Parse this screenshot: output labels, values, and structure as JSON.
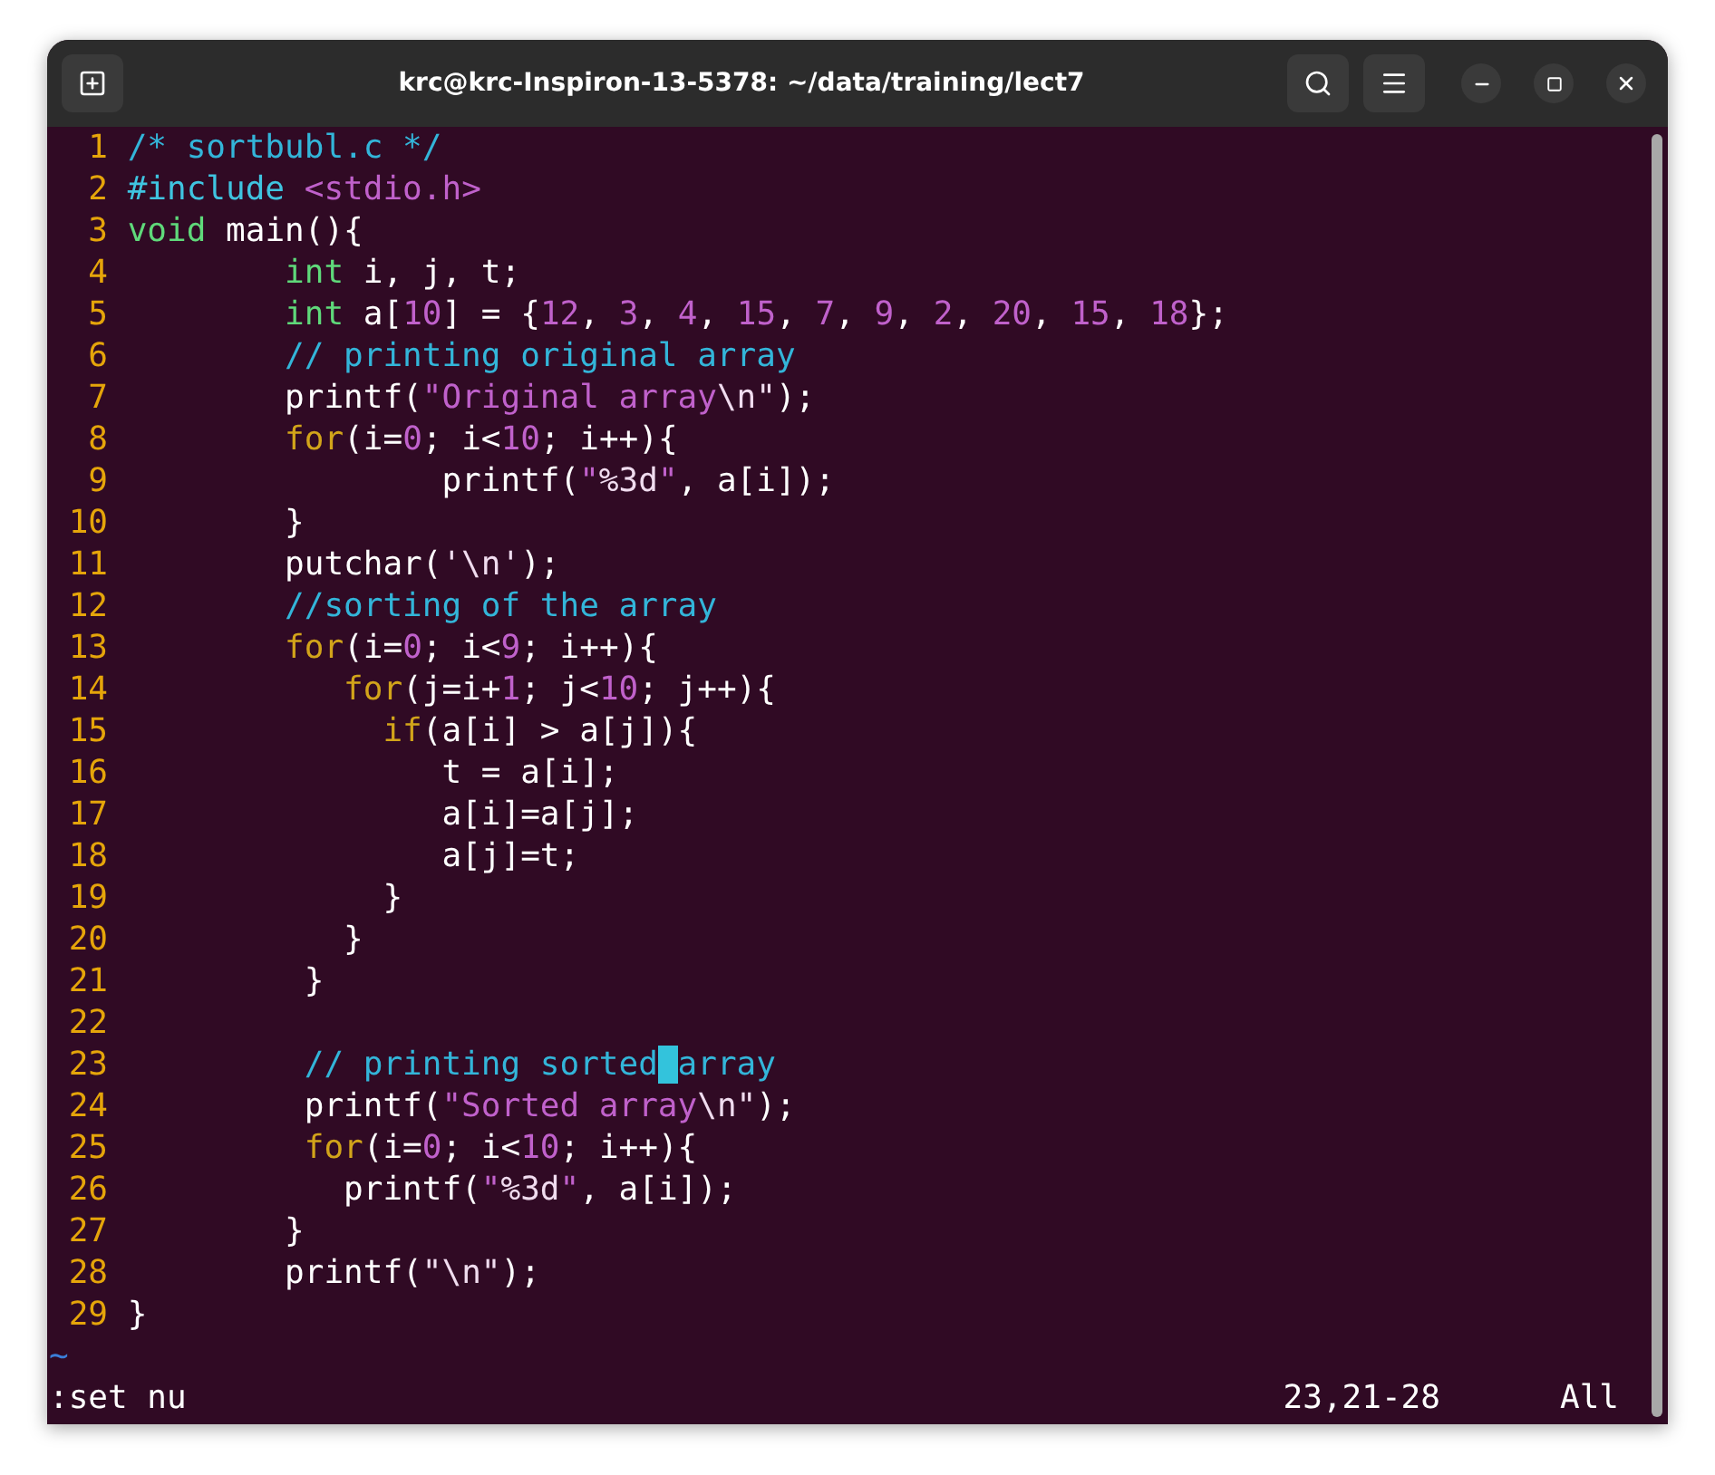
{
  "window": {
    "title": "krc@krc-Inspiron-13-5378: ~/data/training/lect7"
  },
  "editor": {
    "lines": [
      {
        "number": "1",
        "tokens": [
          {
            "kind": "comment",
            "text": "/* sortbubl.c */"
          }
        ]
      },
      {
        "number": "2",
        "tokens": [
          {
            "kind": "preproc",
            "text": "#include"
          },
          {
            "kind": "string",
            "text": " <stdio.h>"
          }
        ]
      },
      {
        "number": "3",
        "tokens": [
          {
            "kind": "type",
            "text": "void"
          },
          {
            "kind": "plain",
            "text": " main(){"
          }
        ]
      },
      {
        "number": "4",
        "tokens": [
          {
            "kind": "type",
            "text": "        int"
          },
          {
            "kind": "plain",
            "text": " i, j, t;"
          }
        ]
      },
      {
        "number": "5",
        "tokens": [
          {
            "kind": "type",
            "text": "        int"
          },
          {
            "kind": "plain",
            "text": " a["
          },
          {
            "kind": "number",
            "text": "10"
          },
          {
            "kind": "plain",
            "text": "] = {"
          },
          {
            "kind": "number",
            "text": "12"
          },
          {
            "kind": "plain",
            "text": ", "
          },
          {
            "kind": "number",
            "text": "3"
          },
          {
            "kind": "plain",
            "text": ", "
          },
          {
            "kind": "number",
            "text": "4"
          },
          {
            "kind": "plain",
            "text": ", "
          },
          {
            "kind": "number",
            "text": "15"
          },
          {
            "kind": "plain",
            "text": ", "
          },
          {
            "kind": "number",
            "text": "7"
          },
          {
            "kind": "plain",
            "text": ", "
          },
          {
            "kind": "number",
            "text": "9"
          },
          {
            "kind": "plain",
            "text": ", "
          },
          {
            "kind": "number",
            "text": "2"
          },
          {
            "kind": "plain",
            "text": ", "
          },
          {
            "kind": "number",
            "text": "20"
          },
          {
            "kind": "plain",
            "text": ", "
          },
          {
            "kind": "number",
            "text": "15"
          },
          {
            "kind": "plain",
            "text": ", "
          },
          {
            "kind": "number",
            "text": "18"
          },
          {
            "kind": "plain",
            "text": "};"
          }
        ]
      },
      {
        "number": "6",
        "tokens": [
          {
            "kind": "comment",
            "text": "        // printing original array"
          }
        ]
      },
      {
        "number": "7",
        "tokens": [
          {
            "kind": "plain",
            "text": "        printf("
          },
          {
            "kind": "string",
            "text": "\"Original array"
          },
          {
            "kind": "special",
            "text": "\\n\""
          },
          {
            "kind": "plain",
            "text": ");"
          }
        ]
      },
      {
        "number": "8",
        "tokens": [
          {
            "kind": "keyword",
            "text": "        for"
          },
          {
            "kind": "plain",
            "text": "(i="
          },
          {
            "kind": "number",
            "text": "0"
          },
          {
            "kind": "plain",
            "text": "; i<"
          },
          {
            "kind": "number",
            "text": "10"
          },
          {
            "kind": "plain",
            "text": "; i++){"
          }
        ]
      },
      {
        "number": "9",
        "tokens": [
          {
            "kind": "plain",
            "text": "                printf("
          },
          {
            "kind": "string",
            "text": "\""
          },
          {
            "kind": "special",
            "text": "%3d"
          },
          {
            "kind": "string",
            "text": "\""
          },
          {
            "kind": "plain",
            "text": ", a[i]);"
          }
        ]
      },
      {
        "number": "10",
        "tokens": [
          {
            "kind": "plain",
            "text": "        }"
          }
        ]
      },
      {
        "number": "11",
        "tokens": [
          {
            "kind": "plain",
            "text": "        putchar("
          },
          {
            "kind": "special",
            "text": "'\\n'"
          },
          {
            "kind": "plain",
            "text": ");"
          }
        ]
      },
      {
        "number": "12",
        "tokens": [
          {
            "kind": "comment",
            "text": "        //sorting of the array"
          }
        ]
      },
      {
        "number": "13",
        "tokens": [
          {
            "kind": "keyword",
            "text": "        for"
          },
          {
            "kind": "plain",
            "text": "(i="
          },
          {
            "kind": "number",
            "text": "0"
          },
          {
            "kind": "plain",
            "text": "; i<"
          },
          {
            "kind": "number",
            "text": "9"
          },
          {
            "kind": "plain",
            "text": "; i++){"
          }
        ]
      },
      {
        "number": "14",
        "tokens": [
          {
            "kind": "keyword",
            "text": "           for"
          },
          {
            "kind": "plain",
            "text": "(j=i+"
          },
          {
            "kind": "number",
            "text": "1"
          },
          {
            "kind": "plain",
            "text": "; j<"
          },
          {
            "kind": "number",
            "text": "10"
          },
          {
            "kind": "plain",
            "text": "; j++){"
          }
        ]
      },
      {
        "number": "15",
        "tokens": [
          {
            "kind": "keyword",
            "text": "             if"
          },
          {
            "kind": "plain",
            "text": "(a[i] > a[j]){"
          }
        ]
      },
      {
        "number": "16",
        "tokens": [
          {
            "kind": "plain",
            "text": "                t = a[i];"
          }
        ]
      },
      {
        "number": "17",
        "tokens": [
          {
            "kind": "plain",
            "text": "                a[i]=a[j];"
          }
        ]
      },
      {
        "number": "18",
        "tokens": [
          {
            "kind": "plain",
            "text": "                a[j]=t;"
          }
        ]
      },
      {
        "number": "19",
        "tokens": [
          {
            "kind": "plain",
            "text": "             }"
          }
        ]
      },
      {
        "number": "20",
        "tokens": [
          {
            "kind": "plain",
            "text": "           }"
          }
        ]
      },
      {
        "number": "21",
        "tokens": [
          {
            "kind": "plain",
            "text": "         }"
          }
        ]
      },
      {
        "number": "22"
      },
      {
        "number": "23",
        "tokens": [
          {
            "kind": "comment",
            "text": "         // printing sorted"
          },
          {
            "kind": "comment",
            "text": " array",
            "cursor": true
          }
        ]
      },
      {
        "number": "24",
        "tokens": [
          {
            "kind": "plain",
            "text": "         printf("
          },
          {
            "kind": "string",
            "text": "\"Sorted array"
          },
          {
            "kind": "special",
            "text": "\\n\""
          },
          {
            "kind": "plain",
            "text": ");"
          }
        ]
      },
      {
        "number": "25",
        "tokens": [
          {
            "kind": "keyword",
            "text": "         for"
          },
          {
            "kind": "plain",
            "text": "(i="
          },
          {
            "kind": "number",
            "text": "0"
          },
          {
            "kind": "plain",
            "text": "; i<"
          },
          {
            "kind": "number",
            "text": "10"
          },
          {
            "kind": "plain",
            "text": "; i++){"
          }
        ]
      },
      {
        "number": "26",
        "tokens": [
          {
            "kind": "plain",
            "text": "           printf("
          },
          {
            "kind": "string",
            "text": "\""
          },
          {
            "kind": "special",
            "text": "%3d"
          },
          {
            "kind": "string",
            "text": "\""
          },
          {
            "kind": "plain",
            "text": ", a[i]);"
          }
        ]
      },
      {
        "number": "27",
        "tokens": [
          {
            "kind": "plain",
            "text": "        }"
          }
        ]
      },
      {
        "number": "28",
        "tokens": [
          {
            "kind": "plain",
            "text": "        printf("
          },
          {
            "kind": "special",
            "text": "\"\\n\""
          },
          {
            "kind": "plain",
            "text": ");"
          }
        ]
      },
      {
        "number": "29",
        "tokens": [
          {
            "kind": "plain",
            "text": "}"
          }
        ]
      }
    ],
    "filler": [
      "~"
    ],
    "command_line": ":set nu",
    "cursor_position": "23,21-28",
    "scroll_position": "All"
  }
}
